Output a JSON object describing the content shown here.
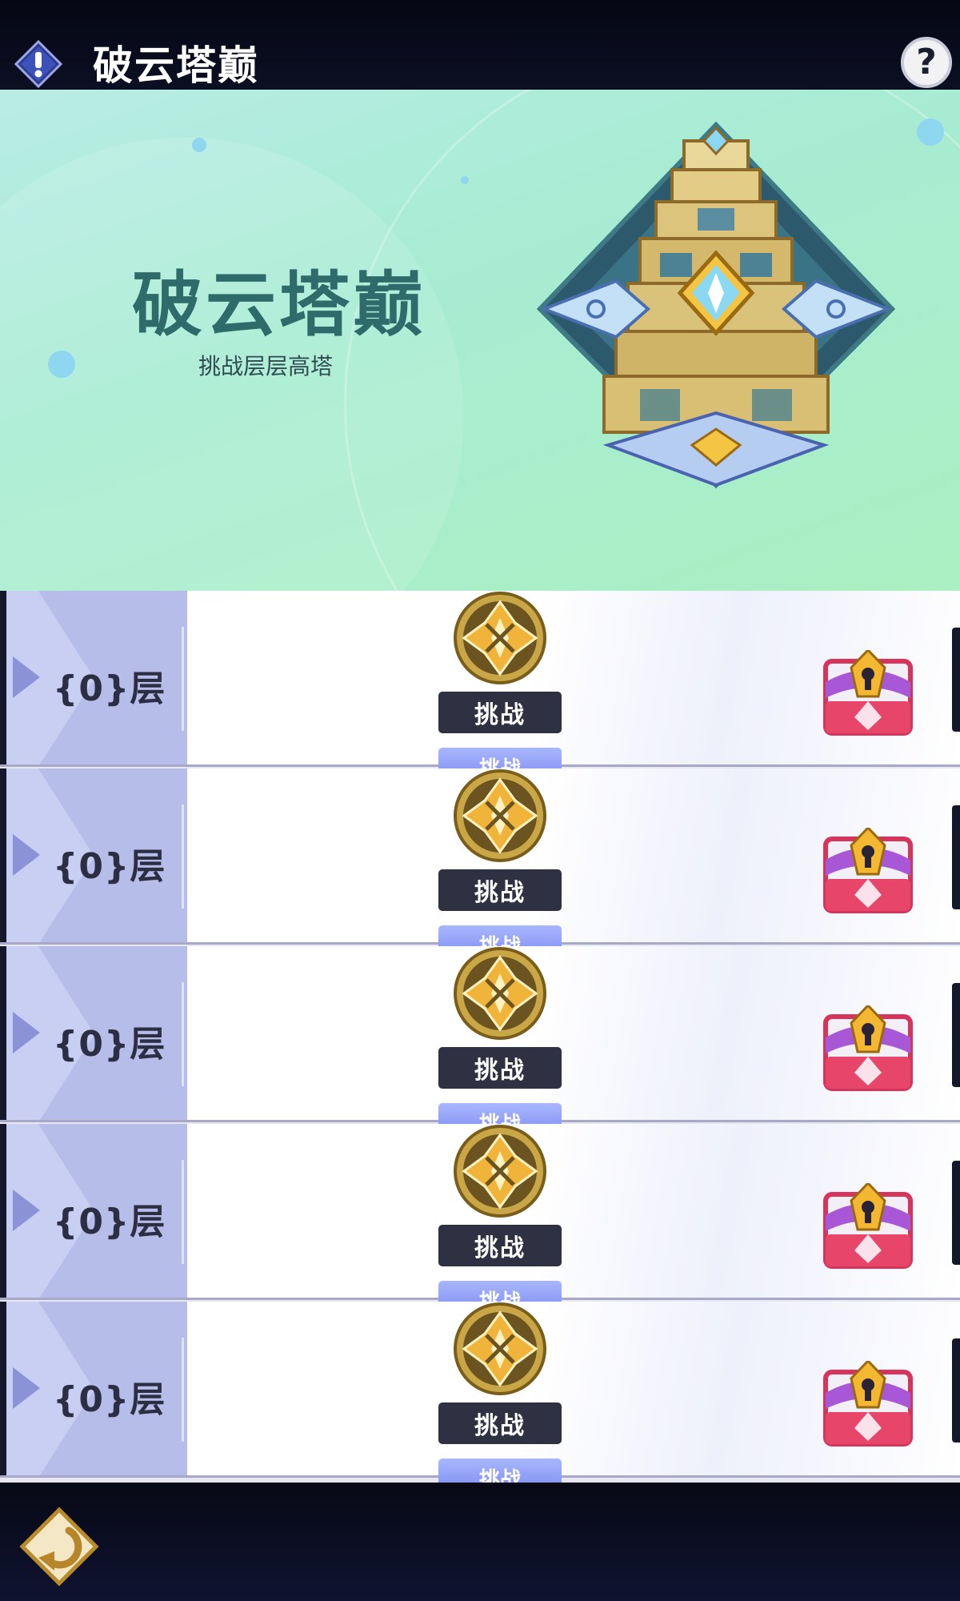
{
  "header": {
    "title": "破云塔巅",
    "info_icon": "exclamation-diamond-icon",
    "help_label": "?"
  },
  "banner": {
    "title": "破云塔巅",
    "subtitle": "挑战层层高塔",
    "emblem": "tower-emblem"
  },
  "floors": [
    {
      "label": "{0}层",
      "button": "挑战",
      "next_button": "挑战"
    },
    {
      "label": "{0}层",
      "button": "挑战",
      "next_button": "挑战"
    },
    {
      "label": "{0}层",
      "button": "挑战",
      "next_button": "挑战"
    },
    {
      "label": "{0}层",
      "button": "挑战",
      "next_button": "挑战"
    },
    {
      "label": "{0}层",
      "button": "挑战",
      "next_button": "挑战"
    }
  ],
  "footer": {
    "back_icon": "back-arrow-icon"
  },
  "colors": {
    "banner_bg": "#a9efc1",
    "title_teal": "#2e6b6a",
    "button_dark": "#2f3142",
    "floor_cell": "#b6bde8"
  }
}
